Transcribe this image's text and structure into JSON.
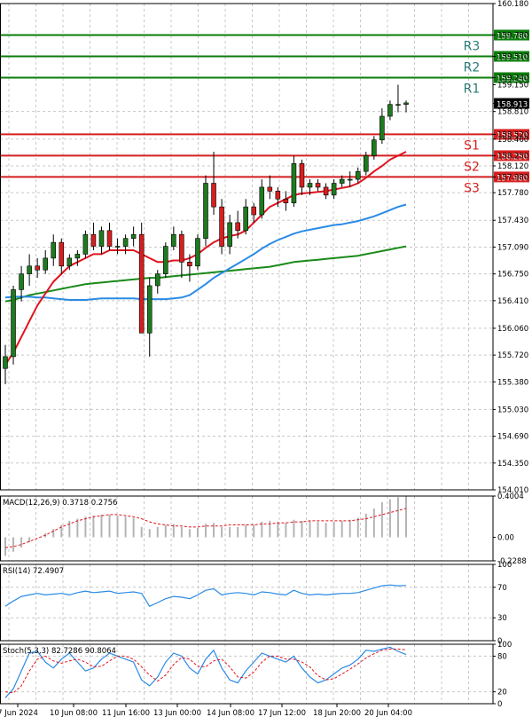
{
  "colors": {
    "background": "#ffffff",
    "grid": "#c8c8c8",
    "axis": "#000000",
    "bull": "#1f7a1f",
    "bear": "#d61f1f",
    "wick": "#000000",
    "sma_fast": "#e0141e",
    "sma_mid": "#2a8be6",
    "sma_slow": "#1a8a1a",
    "resistance": "#0a7d0a",
    "support": "#d61f1f",
    "label_res": "#2a7b74",
    "label_sup": "#d61f1f",
    "badge_bg": "#0a7d0a",
    "badge_sup_bg": "#d61f1f",
    "price_badge_bg": "#000000",
    "macd_hist": "#b4b4b4",
    "macd_signal": "#e0141e",
    "rsi_line": "#2a8be6",
    "stoch_main": "#2a8be6",
    "stoch_signal": "#e0141e"
  },
  "chart_data": [
    {
      "type": "candlestick",
      "panel": "price",
      "ylim": [
        154.01,
        160.18
      ],
      "y_ticks": [
        "160.180",
        "159.780",
        "159.510",
        "159.240",
        "159.150",
        "158.913",
        "158.810",
        "158.520",
        "158.460",
        "158.250",
        "158.120",
        "157.980",
        "157.780",
        "157.430",
        "157.090",
        "156.750",
        "156.410",
        "156.060",
        "155.720",
        "155.380",
        "155.030",
        "154.690",
        "154.350",
        "154.010"
      ],
      "x_tick_labels": [
        "7 Jun 2024",
        "10 Jun 08:00",
        "11 Jun 16:00",
        "13 Jun 00:00",
        "14 Jun 08:00",
        "17 Jun 12:00",
        "18 Jun 20:00",
        "20 Jun 04:00"
      ],
      "current_price": "158.913",
      "levels": [
        {
          "name": "R3",
          "value": 159.78,
          "label": "159.780",
          "kind": "resistance"
        },
        {
          "name": "R2",
          "value": 159.51,
          "label": "159.510",
          "kind": "resistance"
        },
        {
          "name": "R1",
          "value": 159.24,
          "label": "159.240",
          "kind": "resistance"
        },
        {
          "name": "S1",
          "value": 158.52,
          "label": "158.520",
          "kind": "support"
        },
        {
          "name": "S2",
          "value": 158.25,
          "label": "158.250",
          "kind": "support"
        },
        {
          "name": "S3",
          "value": 157.98,
          "label": "157.980",
          "kind": "support"
        }
      ],
      "candles": [
        [
          155.55,
          155.85,
          155.35,
          155.7
        ],
        [
          155.7,
          156.6,
          155.6,
          156.55
        ],
        [
          156.55,
          156.85,
          156.4,
          156.75
        ],
        [
          156.75,
          157.0,
          156.6,
          156.85
        ],
        [
          156.85,
          156.95,
          156.7,
          156.8
        ],
        [
          156.8,
          157.05,
          156.75,
          156.95
        ],
        [
          156.95,
          157.25,
          156.85,
          157.15
        ],
        [
          157.15,
          157.2,
          156.75,
          156.85
        ],
        [
          156.85,
          157.0,
          156.8,
          156.95
        ],
        [
          156.95,
          157.05,
          156.85,
          157.0
        ],
        [
          157.0,
          157.3,
          156.95,
          157.25
        ],
        [
          157.25,
          157.4,
          157.05,
          157.1
        ],
        [
          157.1,
          157.35,
          157.0,
          157.3
        ],
        [
          157.3,
          157.4,
          157.05,
          157.1
        ],
        [
          157.1,
          157.2,
          157.0,
          157.1
        ],
        [
          157.1,
          157.25,
          157.0,
          157.2
        ],
        [
          157.2,
          157.35,
          157.1,
          157.25
        ],
        [
          157.25,
          157.4,
          156.05,
          156.0
        ],
        [
          156.0,
          156.7,
          155.7,
          156.6
        ],
        [
          156.6,
          156.8,
          156.5,
          156.75
        ],
        [
          156.75,
          157.15,
          156.7,
          157.1
        ],
        [
          157.1,
          157.35,
          157.05,
          157.25
        ],
        [
          157.25,
          157.3,
          156.7,
          156.9
        ],
        [
          156.9,
          157.0,
          156.65,
          156.85
        ],
        [
          156.85,
          157.25,
          156.8,
          157.2
        ],
        [
          157.2,
          158.0,
          157.1,
          157.9
        ],
        [
          157.9,
          158.3,
          157.5,
          157.6
        ],
        [
          157.6,
          157.7,
          157.0,
          157.1
        ],
        [
          157.1,
          157.5,
          157.0,
          157.4
        ],
        [
          157.4,
          157.55,
          157.2,
          157.3
        ],
        [
          157.3,
          157.7,
          157.25,
          157.6
        ],
        [
          157.6,
          157.65,
          157.4,
          157.5
        ],
        [
          157.5,
          157.95,
          157.45,
          157.85
        ],
        [
          157.85,
          158.0,
          157.7,
          157.8
        ],
        [
          157.8,
          157.85,
          157.6,
          157.7
        ],
        [
          157.7,
          157.8,
          157.55,
          157.65
        ],
        [
          157.65,
          158.25,
          157.6,
          158.15
        ],
        [
          158.15,
          158.2,
          157.75,
          157.85
        ],
        [
          157.85,
          157.95,
          157.75,
          157.9
        ],
        [
          157.9,
          157.95,
          157.8,
          157.85
        ],
        [
          157.85,
          157.9,
          157.7,
          157.75
        ],
        [
          157.75,
          157.95,
          157.7,
          157.9
        ],
        [
          157.9,
          158.0,
          157.85,
          157.95
        ],
        [
          157.95,
          158.05,
          157.85,
          157.95
        ],
        [
          157.95,
          158.1,
          157.9,
          158.05
        ],
        [
          158.05,
          158.3,
          158.0,
          158.25
        ],
        [
          158.25,
          158.5,
          158.2,
          158.45
        ],
        [
          158.45,
          158.85,
          158.4,
          158.75
        ],
        [
          158.75,
          158.95,
          158.7,
          158.9
        ],
        [
          158.9,
          159.15,
          158.8,
          158.9
        ],
        [
          158.9,
          158.95,
          158.8,
          158.92
        ]
      ],
      "sma_fast": [
        155.6,
        155.75,
        155.95,
        156.15,
        156.35,
        156.5,
        156.65,
        156.75,
        156.85,
        156.9,
        156.95,
        157.0,
        157.0,
        157.05,
        157.05,
        157.05,
        157.05,
        157.0,
        156.95,
        156.9,
        156.9,
        156.92,
        156.92,
        156.95,
        157.0,
        157.08,
        157.15,
        157.2,
        157.23,
        157.25,
        157.3,
        157.4,
        157.5,
        157.6,
        157.65,
        157.7,
        157.75,
        157.77,
        157.78,
        157.79,
        157.8,
        157.82,
        157.84,
        157.86,
        157.9,
        157.97,
        158.05,
        158.12,
        158.2,
        158.25,
        158.3
      ],
      "sma_mid": [
        156.45,
        156.46,
        156.46,
        156.46,
        156.45,
        156.45,
        156.44,
        156.43,
        156.42,
        156.42,
        156.42,
        156.43,
        156.44,
        156.44,
        156.44,
        156.44,
        156.44,
        156.43,
        156.43,
        156.43,
        156.43,
        156.44,
        156.45,
        156.48,
        156.55,
        156.62,
        156.7,
        156.76,
        156.82,
        156.88,
        156.94,
        157.0,
        157.07,
        157.13,
        157.18,
        157.22,
        157.26,
        157.29,
        157.31,
        157.33,
        157.35,
        157.37,
        157.38,
        157.4,
        157.42,
        157.45,
        157.48,
        157.52,
        157.56,
        157.6,
        157.63
      ],
      "sma_slow": [
        156.4,
        156.42,
        156.45,
        156.48,
        156.5,
        156.52,
        156.54,
        156.56,
        156.58,
        156.6,
        156.62,
        156.63,
        156.64,
        156.65,
        156.66,
        156.67,
        156.68,
        156.69,
        156.7,
        156.7,
        156.71,
        156.72,
        156.73,
        156.74,
        156.75,
        156.76,
        156.77,
        156.78,
        156.79,
        156.8,
        156.81,
        156.82,
        156.83,
        156.84,
        156.86,
        156.88,
        156.9,
        156.91,
        156.92,
        156.93,
        156.94,
        156.95,
        156.96,
        156.97,
        156.98,
        157.0,
        157.02,
        157.04,
        157.06,
        157.08,
        157.1
      ]
    },
    {
      "type": "bar",
      "panel": "macd",
      "title": "MACD(12,26,9) 0.3718 0.2756",
      "ylim": [
        -0.2288,
        0.4004
      ],
      "y_ticks": [
        "0.4004",
        "0.00",
        "-0.2288"
      ],
      "histogram": [
        -0.18,
        -0.14,
        -0.1,
        -0.05,
        0.0,
        0.04,
        0.08,
        0.12,
        0.16,
        0.18,
        0.2,
        0.21,
        0.22,
        0.22,
        0.21,
        0.2,
        0.19,
        0.1,
        0.08,
        0.1,
        0.12,
        0.13,
        0.1,
        0.08,
        0.09,
        0.13,
        0.14,
        0.1,
        0.1,
        0.1,
        0.12,
        0.12,
        0.15,
        0.16,
        0.15,
        0.14,
        0.17,
        0.16,
        0.16,
        0.15,
        0.14,
        0.15,
        0.16,
        0.17,
        0.19,
        0.23,
        0.28,
        0.34,
        0.37,
        0.39,
        0.4
      ],
      "signal": [
        -0.1,
        -0.09,
        -0.07,
        -0.04,
        -0.01,
        0.02,
        0.06,
        0.1,
        0.13,
        0.16,
        0.18,
        0.2,
        0.21,
        0.22,
        0.22,
        0.21,
        0.2,
        0.18,
        0.15,
        0.13,
        0.12,
        0.11,
        0.11,
        0.1,
        0.1,
        0.11,
        0.11,
        0.11,
        0.12,
        0.12,
        0.12,
        0.12,
        0.13,
        0.13,
        0.14,
        0.14,
        0.15,
        0.15,
        0.16,
        0.16,
        0.16,
        0.16,
        0.16,
        0.16,
        0.17,
        0.18,
        0.2,
        0.22,
        0.24,
        0.26,
        0.28
      ]
    },
    {
      "type": "line",
      "panel": "rsi",
      "title": "RSI(14) 72.4907",
      "ylim": [
        0,
        100
      ],
      "y_ticks": [
        "100",
        "70",
        "30",
        "0"
      ],
      "values": [
        45,
        52,
        58,
        60,
        62,
        60,
        61,
        62,
        60,
        63,
        65,
        63,
        64,
        65,
        62,
        63,
        64,
        62,
        45,
        50,
        55,
        58,
        57,
        55,
        60,
        66,
        68,
        60,
        62,
        63,
        62,
        60,
        64,
        63,
        61,
        60,
        66,
        62,
        60,
        61,
        60,
        61,
        62,
        62,
        63,
        66,
        69,
        72,
        73,
        72,
        72.49
      ]
    },
    {
      "type": "line",
      "panel": "stochastic",
      "title": "Stoch(5,3,3) 82.7286 90.8064",
      "ylim": [
        0,
        100
      ],
      "y_ticks": [
        "100",
        "80",
        "20",
        "0"
      ],
      "main": [
        10,
        25,
        55,
        85,
        88,
        70,
        60,
        75,
        85,
        70,
        55,
        60,
        75,
        85,
        80,
        75,
        70,
        40,
        30,
        45,
        70,
        85,
        80,
        60,
        50,
        75,
        90,
        60,
        40,
        35,
        55,
        70,
        85,
        80,
        75,
        70,
        80,
        60,
        45,
        35,
        40,
        50,
        60,
        65,
        75,
        90,
        88,
        92,
        95,
        88,
        82.73
      ],
      "signal": [
        20,
        18,
        30,
        55,
        75,
        80,
        72,
        68,
        72,
        75,
        70,
        62,
        63,
        72,
        80,
        80,
        75,
        62,
        48,
        38,
        48,
        66,
        78,
        75,
        63,
        62,
        72,
        75,
        62,
        45,
        43,
        53,
        70,
        80,
        80,
        75,
        75,
        70,
        62,
        47,
        40,
        42,
        50,
        58,
        67,
        77,
        84,
        90,
        92,
        92,
        90.81
      ]
    }
  ]
}
